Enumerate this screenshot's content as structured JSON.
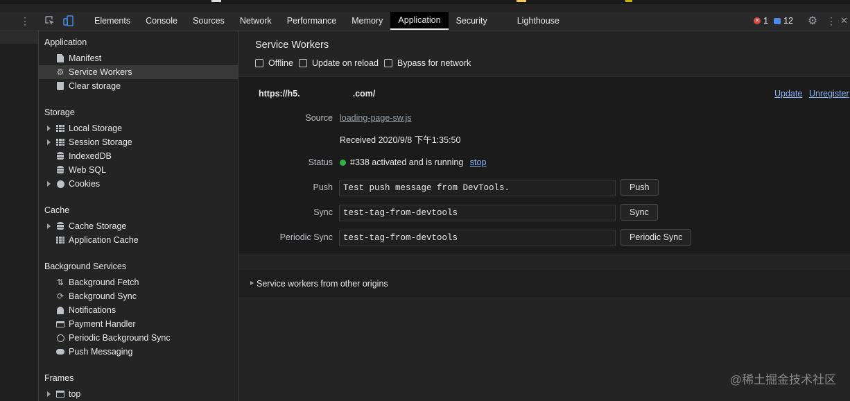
{
  "toolbar": {
    "tabs": [
      "Elements",
      "Console",
      "Sources",
      "Network",
      "Performance",
      "Memory",
      "Application",
      "Security",
      "Lighthouse"
    ],
    "active_tab": "Application",
    "errors_count": "1",
    "messages_count": "12"
  },
  "sidebar": {
    "application": {
      "title": "Application",
      "items": [
        "Manifest",
        "Service Workers",
        "Clear storage"
      ]
    },
    "storage": {
      "title": "Storage",
      "items": [
        "Local Storage",
        "Session Storage",
        "IndexedDB",
        "Web SQL",
        "Cookies"
      ]
    },
    "cache": {
      "title": "Cache",
      "items": [
        "Cache Storage",
        "Application Cache"
      ]
    },
    "background": {
      "title": "Background Services",
      "items": [
        "Background Fetch",
        "Background Sync",
        "Notifications",
        "Payment Handler",
        "Periodic Background Sync",
        "Push Messaging"
      ]
    },
    "frames": {
      "title": "Frames",
      "items": [
        "top"
      ]
    }
  },
  "main": {
    "title": "Service Workers",
    "options": [
      "Offline",
      "Update on reload",
      "Bypass for network"
    ],
    "worker": {
      "origin_prefix": "https://h5.",
      "origin_suffix": ".com/",
      "update_link": "Update",
      "unregister_link": "Unregister",
      "source_label": "Source",
      "source_file": "loading-page-sw.js",
      "received": "Received 2020/9/8 下午1:35:50",
      "status_label": "Status",
      "status_text": "#338 activated and is running",
      "stop_link": "stop",
      "push_label": "Push",
      "push_value": "Test push message from DevTools.",
      "push_button": "Push",
      "sync_label": "Sync",
      "sync_value": "test-tag-from-devtools",
      "sync_button": "Sync",
      "periodic_label": "Periodic Sync",
      "periodic_value": "test-tag-from-devtools",
      "periodic_button": "Periodic Sync"
    },
    "other_origins": "Service workers from other origins"
  },
  "watermark": "@稀土掘金技术社区",
  "colors": {
    "background": "#242424",
    "panel": "#1b1b1b",
    "link": "#8ab4f8",
    "status_ok": "#2fb14a",
    "error": "#e0473e"
  }
}
